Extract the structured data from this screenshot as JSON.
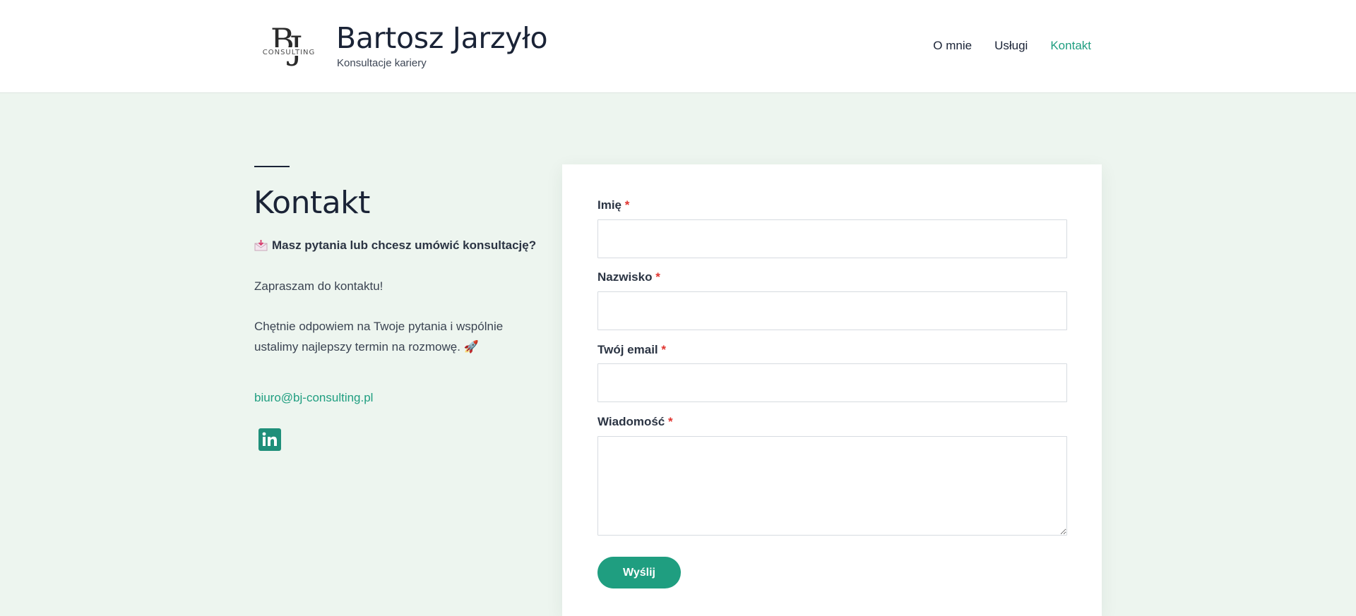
{
  "header": {
    "logo_mark": "BJ",
    "logo_text": "CONSULTING",
    "title": "Bartosz Jarzyło",
    "tagline": "Konsultacje kariery",
    "nav": [
      {
        "label": "O mnie",
        "active": false
      },
      {
        "label": "Usługi",
        "active": false
      },
      {
        "label": "Kontakt",
        "active": true
      }
    ]
  },
  "intro": {
    "title": "Kontakt",
    "question": "Masz pytania lub chcesz umówić konsultację?",
    "paragraph1": "Zapraszam do kontaktu!",
    "paragraph2": "Chętnie odpowiem na Twoje pytania i wspólnie ustalimy najlepszy termin na rozmowę. 🚀",
    "email": "biuro@bj-consulting.pl",
    "social_icon": "linkedin-icon"
  },
  "form": {
    "fields": [
      {
        "label": "Imię",
        "required_mark": "*",
        "value": ""
      },
      {
        "label": "Nazwisko",
        "required_mark": "*",
        "value": ""
      },
      {
        "label": "Twój email",
        "required_mark": "*",
        "value": ""
      },
      {
        "label": "Wiadomość",
        "required_mark": "*",
        "value": ""
      }
    ],
    "submit_label": "Wyślij"
  },
  "colors": {
    "accent": "#1f9e80",
    "background": "#edf5ef",
    "text": "#1a2336",
    "required": "#e0342f"
  }
}
